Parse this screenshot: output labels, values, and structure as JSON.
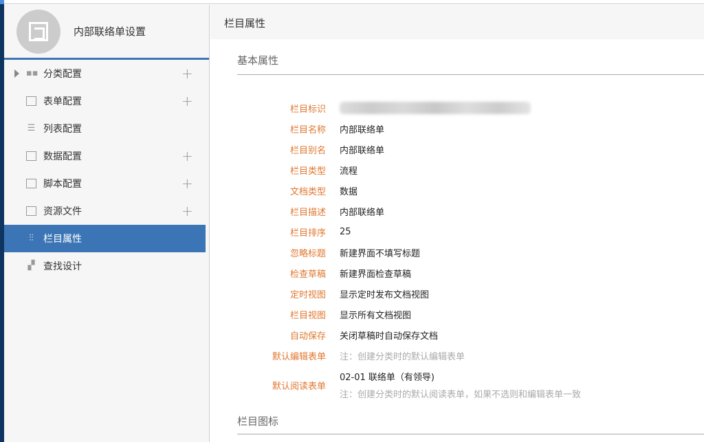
{
  "sidebar": {
    "title": "内部联络单设置",
    "items": [
      {
        "label": "分类配置",
        "icon": "shapes-icon",
        "plus": "+"
      },
      {
        "label": "表单配置",
        "icon": "form-icon",
        "plus": "+"
      },
      {
        "label": "列表配置",
        "icon": "list-icon"
      },
      {
        "label": "数据配置",
        "icon": "chart-icon",
        "plus": "+"
      },
      {
        "label": "脚本配置",
        "icon": "terminal-icon",
        "plus": "+"
      },
      {
        "label": "资源文件",
        "icon": "terminal-icon",
        "plus": "+"
      },
      {
        "label": "栏目属性",
        "icon": "sliders-icon"
      },
      {
        "label": "查找设计",
        "icon": "binoculars-icon"
      }
    ]
  },
  "main": {
    "title": "栏目属性",
    "section1": "基本属性",
    "section2": "栏目图标",
    "props": [
      {
        "k": "栏目标识",
        "v": ""
      },
      {
        "k": "栏目名称",
        "v": "内部联络单"
      },
      {
        "k": "栏目别名",
        "v": "内部联络单"
      },
      {
        "k": "栏目类型",
        "v": "流程"
      },
      {
        "k": "文档类型",
        "v": "数据"
      },
      {
        "k": "栏目描述",
        "v": "内部联络单"
      },
      {
        "k": "栏目排序",
        "v": "25"
      },
      {
        "k": "忽略标题",
        "v": "新建界面不填写标题"
      },
      {
        "k": "检查草稿",
        "v": "新建界面检查草稿"
      },
      {
        "k": "定时视图",
        "v": "显示定时发布文档视图"
      },
      {
        "k": "栏目视图",
        "v": "显示所有文档视图"
      },
      {
        "k": "自动保存",
        "v": "关闭草稿时自动保存文档"
      },
      {
        "k": "默认编辑表单",
        "note": "注：创建分类时的默认编辑表单"
      },
      {
        "k": "默认阅读表单",
        "v": "02-01 联络单（有领导)",
        "note": "注：创建分类时的默认阅读表单，如果不选则和编辑表单一致"
      }
    ]
  },
  "colors": {
    "accent": "#3b75b5",
    "label": "#e0772f"
  }
}
